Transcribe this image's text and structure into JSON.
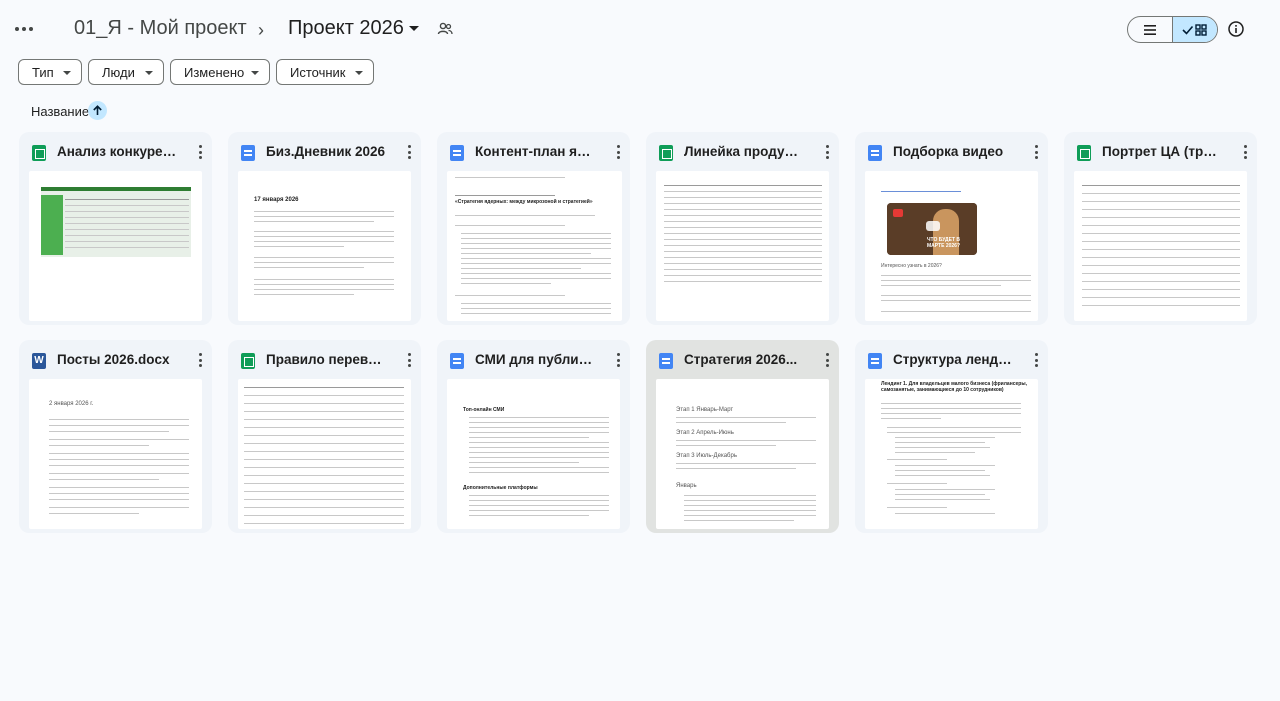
{
  "breadcrumb": {
    "parent": "01_Я - Мой проект",
    "current": "Проект 2026"
  },
  "filters": [
    "Тип",
    "Люди",
    "Изменено",
    "Источник"
  ],
  "sort": {
    "label": "Название"
  },
  "view": {
    "mode": "grid"
  },
  "files": [
    {
      "title": "Анализ конкурентов",
      "type": "sheet",
      "icon": "sheets-shortcut-icon"
    },
    {
      "title": "Биз.Дневник 2026",
      "type": "doc",
      "icon": "docs-icon",
      "preview_heading": "17 января 2026"
    },
    {
      "title": "Контент-план январь",
      "type": "doc",
      "icon": "docs-icon",
      "preview_heading": "«Стратегия ядерных: между микрозоной и стратегией»"
    },
    {
      "title": "Линейка продуктов",
      "type": "sheet",
      "icon": "sheets-icon"
    },
    {
      "title": "Подборка видео",
      "type": "doc",
      "icon": "docs-icon",
      "preview_heading": "ЧТО БУДЕТ В МАРТЕ 2026?",
      "preview_caption": "Интересно узнать в 2026?"
    },
    {
      "title": "Портрет ЦА (три...",
      "type": "sheet",
      "icon": "sheets-icon"
    },
    {
      "title": "Посты 2026.docx",
      "type": "word",
      "icon": "word-icon",
      "preview_heading": "2 января 2026 г."
    },
    {
      "title": "Правило переворота",
      "type": "sheet",
      "icon": "sheets-icon"
    },
    {
      "title": "СМИ для публикаций",
      "type": "doc",
      "icon": "docs-icon",
      "preview_heading": "Топ-онлайн СМИ",
      "preview_subheading": "Дополнительные платформы"
    },
    {
      "title": "Стратегия 2026...",
      "type": "doc",
      "icon": "docs-icon",
      "selected": true,
      "preview_heading": "Этап 1 Январь-Март",
      "preview_sections": [
        "Этап 2 Апрель-Июнь",
        "Этап 3 Июль-Декабрь",
        "Январь"
      ]
    },
    {
      "title": "Структура лендингов",
      "type": "doc",
      "icon": "docs-icon",
      "preview_heading": "Лендинг 1. Для владельцев малого бизнеса (фрилансеры, самозанятые, занимающиеся до 10 сотрудников)"
    }
  ]
}
